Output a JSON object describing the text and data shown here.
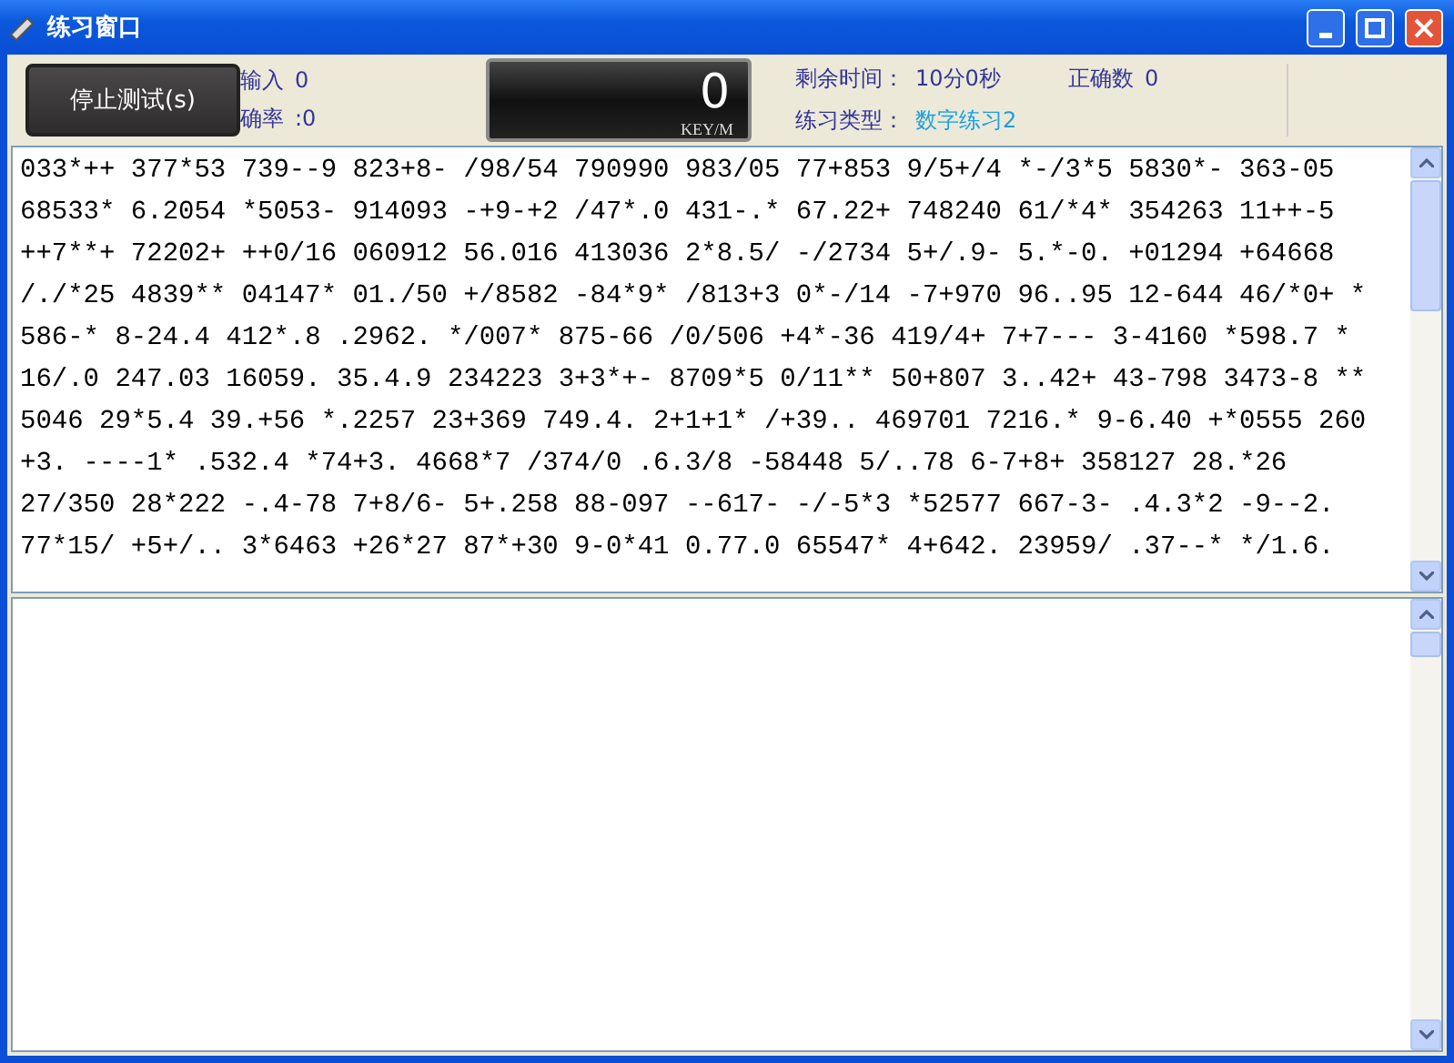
{
  "window": {
    "title": "练习窗口"
  },
  "stop_button": {
    "label": "停止测试(s)"
  },
  "stats_left": [
    {
      "label": "输入",
      "value": "0"
    },
    {
      "label": "确率",
      "value": ":0"
    }
  ],
  "speed": {
    "value": "0",
    "unit": "KEY/M"
  },
  "stats_right": [
    {
      "label": "剩余时间：",
      "value": "10分0秒"
    },
    {
      "label": "正确数",
      "value": "0"
    },
    {
      "label": "练习类型：",
      "value": "数字练习2"
    }
  ],
  "practice_text": [
    "033*++ 377*53 739--9 823+8- /98/54 790990 983/05 77+853 9/5+/4 *-/3*5 5830*- 363-05",
    "68533* 6.2054 *5053- 914093 -+9-+2 /47*.0 431-.* 67.22+ 748240 61/*4* 354263 11++-5",
    "++7**+ 72202+ ++0/16 060912 56.016 413036 2*8.5/ -/2734 5+/.9- 5.*-0. +01294 +64668",
    "/./*25 4839** 04147* 01./50 +/8582 -84*9* /813+3 0*-/14 -7+970 96..95 12-644 46/*0+ *",
    "586-* 8-24.4 412*.8 .2962. */007* 875-66 /0/506 +4*-36 419/4+ 7+7--- 3-4160 *598.7 *",
    "16/.0 247.03 16059. 35.4.9 234223 3+3*+- 8709*5 0/11** 50+807 3..42+ 43-798 3473-8 **",
    "5046 29*5.4 39.+56 *.2257 23+369 749.4. 2+1+1* /+39.. 469701 7216.* 9-6.40 +*0555 260",
    "+3. ----1* .532.4 *74+3. 4668*7 /374/0 .6.3/8 -58448 5/..78 6-7+8+ 358127 28.*26",
    "27/350 28*222 -.4-78 7+8/6- 5+.258 88-097 --617- -/-5*3 *52577 667-3- .4.3*2 -9--2.",
    "77*15/ +5+/.. 3*6463 +26*27 87*+30 9-0*41 0.77.0 65547* 4+642. 23959/ .37--* */1.6."
  ]
}
